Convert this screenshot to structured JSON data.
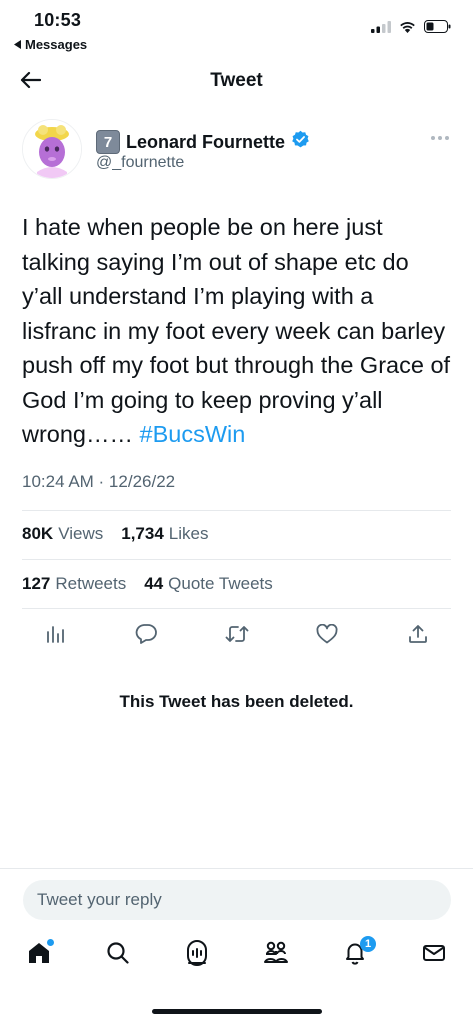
{
  "status_bar": {
    "time": "10:53",
    "back_app_label": "Messages"
  },
  "header": {
    "title": "Tweet"
  },
  "tweet": {
    "emoji_prefix": "7",
    "display_name": "Leonard Fournette",
    "handle": "@_fournette",
    "text": "I hate when people be on here just talking saying I’m out of shape etc do y’all understand I’m playing with a lisfranc in my foot every week can barley push off my foot but through the Grace of God I’m going to keep proving y’all wrong…… ",
    "hashtag": "#BucsWin",
    "timestamp": "10:24 AM · 12/26/22",
    "views_count": "80K",
    "views_label": "Views",
    "likes_count": "1,734",
    "likes_label": "Likes",
    "retweets_count": "127",
    "retweets_label": "Retweets",
    "quotes_count": "44",
    "quotes_label": "Quote Tweets"
  },
  "quoted_tweet": {
    "deleted_message": "This Tweet has been deleted."
  },
  "reply": {
    "placeholder": "Tweet your reply"
  },
  "tab_bar": {
    "notifications_badge": "1",
    "icons": [
      "home-icon",
      "search-icon",
      "spaces-icon",
      "communities-icon",
      "notifications-icon",
      "messages-icon"
    ]
  },
  "colors": {
    "accent": "#1d9bf0",
    "text": "#0f1419",
    "secondary": "#536471"
  }
}
